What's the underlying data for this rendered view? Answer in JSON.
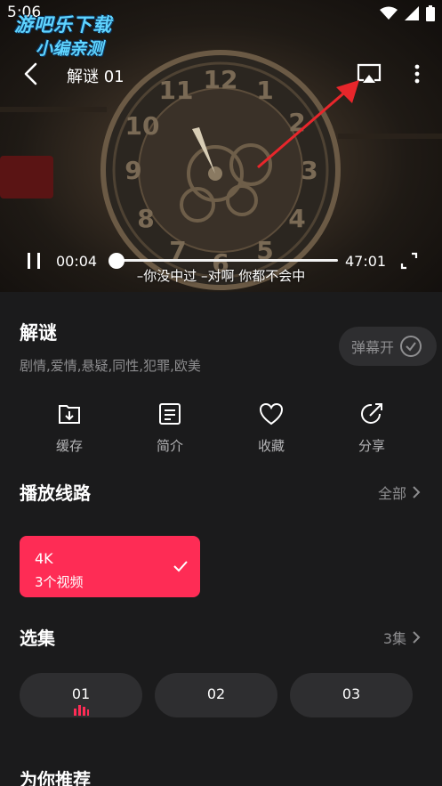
{
  "status_bar": {
    "time": "5:06"
  },
  "watermark": {
    "line1": "游吧乐下载",
    "line2": "小编亲测"
  },
  "player": {
    "title": "解谜 01",
    "current_time": "00:04",
    "total_time": "47:01",
    "progress": 0.0014,
    "subtitle": "–你没中过 –对啊 你都不会中"
  },
  "show": {
    "title": "解谜",
    "tags": "剧情,爱情,悬疑,同性,犯罪,欧美",
    "danmaku_label": "弹幕开"
  },
  "actions": [
    {
      "label": "缓存",
      "icon": "download-icon"
    },
    {
      "label": "简介",
      "icon": "document-icon"
    },
    {
      "label": "收藏",
      "icon": "heart-icon"
    },
    {
      "label": "分享",
      "icon": "share-icon"
    }
  ],
  "routes": {
    "title": "播放线路",
    "link": "全部",
    "items": [
      {
        "name": "4K",
        "count": "3个视频",
        "selected": true
      }
    ]
  },
  "episodes": {
    "title": "选集",
    "link": "3集",
    "items": [
      {
        "label": "01",
        "playing": true
      },
      {
        "label": "02"
      },
      {
        "label": "03"
      }
    ]
  },
  "recommend": {
    "title": "为你推荐"
  },
  "colors": {
    "accent": "#fe2c55",
    "background": "#1b1b1c",
    "chip": "#2e2e30",
    "arrow": "#e8262b"
  }
}
